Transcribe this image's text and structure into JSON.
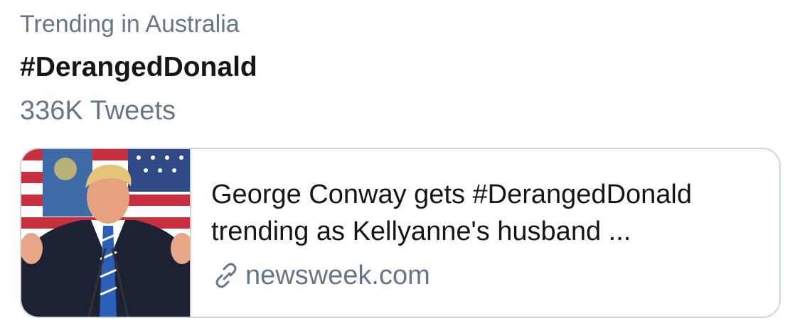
{
  "trend": {
    "context": "Trending in Australia",
    "hashtag": "#DerangedDonald",
    "tweet_count": "336K Tweets"
  },
  "card": {
    "title": "George Conway gets #DerangedDonald trending as Kellyanne's husband ...",
    "domain": "newsweek.com",
    "domain_icon": "link-icon",
    "thumbnail_subject": "man in suit and striped tie speaking at podium in front of flags"
  },
  "colors": {
    "primary_text": "#14171a",
    "secondary_text": "#657786",
    "border": "#ccd6dd",
    "background": "#ffffff"
  }
}
